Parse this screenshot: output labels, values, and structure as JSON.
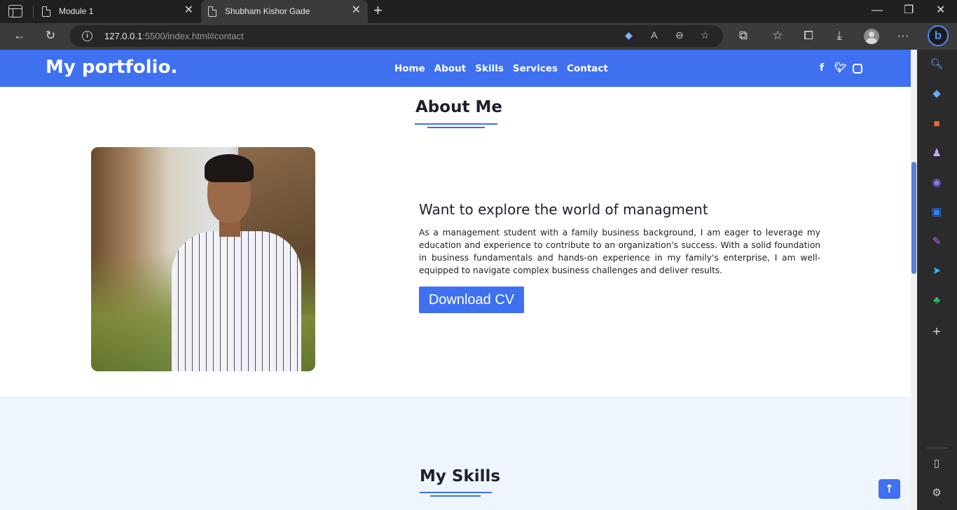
{
  "browser": {
    "tabs": [
      {
        "title": "Module 1",
        "active": false
      },
      {
        "title": "Shubham Kishor Gade",
        "active": true
      }
    ],
    "address": {
      "host": "127.0.0.1",
      "rest": ":5500/index.html#contact"
    }
  },
  "site": {
    "logo": "My portfolio.",
    "nav": [
      "Home",
      "About",
      "Skills",
      "Services",
      "Contact"
    ],
    "social_icons": [
      "facebook-icon",
      "twitter-icon",
      "instagram-icon"
    ]
  },
  "about": {
    "section_title": "About Me",
    "heading": "Want to explore the world of managment",
    "paragraph": "As a management student with a family business background, I am eager to leverage my education and experience to contribute to an organization's success. With a solid foundation in business fundamentals and hands-on experience in my family's enterprise, I am well-equipped to navigate complex business challenges and deliver results.",
    "button_label": "Download CV"
  },
  "skills": {
    "section_title": "My Skills"
  },
  "colors": {
    "accent": "#3e70f0",
    "skills_bg": "#eef5fc",
    "browser_dark": "#202020"
  }
}
